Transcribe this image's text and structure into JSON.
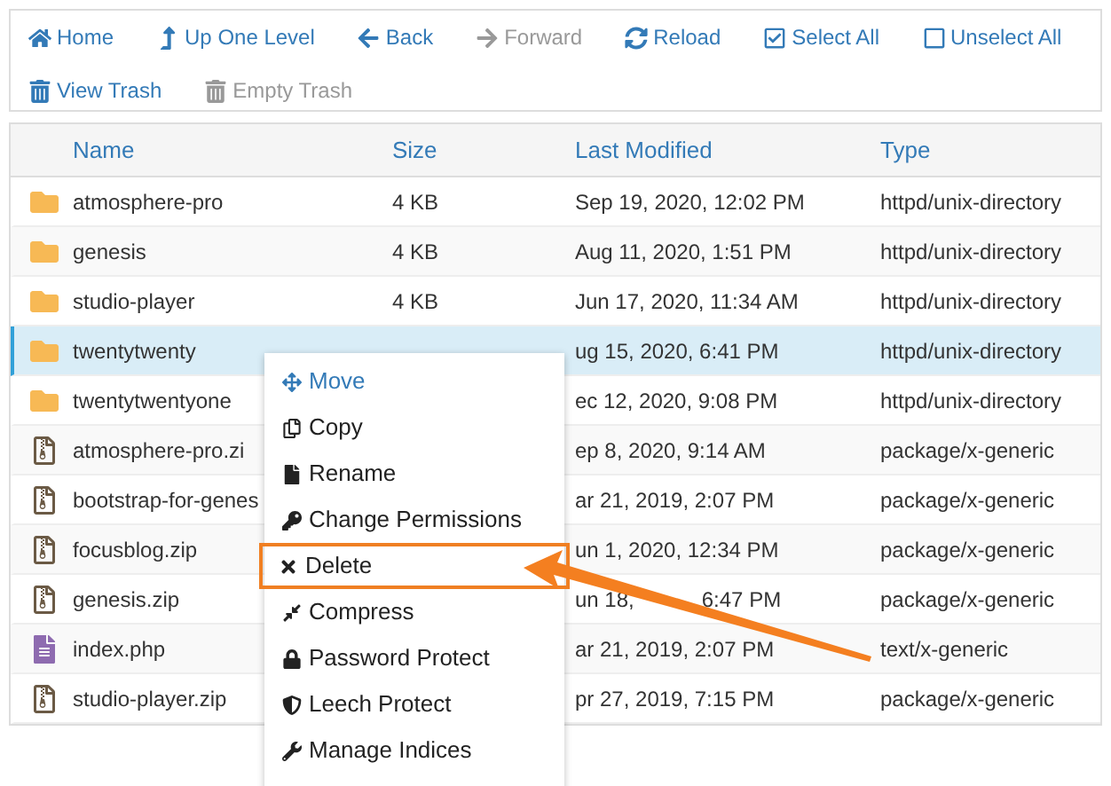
{
  "toolbar": [
    {
      "kind": "home",
      "label": "Home",
      "disabled": false
    },
    {
      "kind": "up",
      "label": "Up One Level",
      "disabled": false
    },
    {
      "kind": "back",
      "label": "Back",
      "disabled": false
    },
    {
      "kind": "forward",
      "label": "Forward",
      "disabled": true
    },
    {
      "kind": "reload",
      "label": "Reload",
      "disabled": false
    },
    {
      "kind": "select_all",
      "label": "Select All",
      "disabled": false
    },
    {
      "kind": "unselect_all",
      "label": "Unselect All",
      "disabled": false
    },
    {
      "kind": "view_trash",
      "label": "View Trash",
      "disabled": false
    },
    {
      "kind": "empty_trash",
      "label": "Empty Trash",
      "disabled": true
    }
  ],
  "table": {
    "columns": [
      "Name",
      "Size",
      "Last Modified",
      "Type"
    ],
    "rows": [
      {
        "kind": "folder",
        "name": "atmosphere-pro",
        "size": "4 KB",
        "modified": "Sep 19, 2020, 12:02 PM",
        "type": "httpd/unix-directory",
        "selected": false
      },
      {
        "kind": "folder",
        "name": "genesis",
        "size": "4 KB",
        "modified": "Aug 11, 2020, 1:51 PM",
        "type": "httpd/unix-directory",
        "selected": false
      },
      {
        "kind": "folder",
        "name": "studio-player",
        "size": "4 KB",
        "modified": "Jun 17, 2020, 11:34 AM",
        "type": "httpd/unix-directory",
        "selected": false
      },
      {
        "kind": "folder",
        "name": "twentytwenty",
        "modified": "ug 15, 2020, 6:41 PM",
        "type": "httpd/unix-directory",
        "selected": true
      },
      {
        "kind": "folder",
        "name": "twentytwentyone",
        "modified": "ec 12, 2020, 9:08 PM",
        "type": "httpd/unix-directory",
        "selected": false
      },
      {
        "kind": "archive",
        "name": "atmosphere-pro.zi",
        "modified": "ep 8, 2020, 9:14 AM",
        "type": "package/x-generic",
        "selected": false
      },
      {
        "kind": "archive",
        "name": "bootstrap-for-genes",
        "modified": "ar 21, 2019, 2:07 PM",
        "type": "package/x-generic",
        "selected": false
      },
      {
        "kind": "archive",
        "name": "focusblog.zip",
        "modified": "un 1, 2020, 12:34 PM",
        "type": "package/x-generic",
        "selected": false
      },
      {
        "kind": "archive",
        "name": "genesis.zip",
        "modified": "un 18,",
        "modified_tail": "6:47 PM",
        "type": "package/x-generic",
        "selected": false
      },
      {
        "kind": "text",
        "name": "index.php",
        "modified": "ar 21, 2019, 2:07 PM",
        "type": "text/x-generic",
        "selected": false
      },
      {
        "kind": "archive",
        "name": "studio-player.zip",
        "modified": "pr 27, 2019, 7:15 PM",
        "type": "package/x-generic",
        "selected": false
      }
    ]
  },
  "context_menu": {
    "items": [
      {
        "kind": "move",
        "label": "Move",
        "active": true,
        "highlighted": false
      },
      {
        "kind": "copy",
        "label": "Copy",
        "active": false,
        "highlighted": false
      },
      {
        "kind": "rename",
        "label": "Rename",
        "active": false,
        "highlighted": false
      },
      {
        "kind": "permissions",
        "label": "Change Permissions",
        "active": false,
        "highlighted": false
      },
      {
        "kind": "delete",
        "label": "Delete",
        "active": false,
        "highlighted": true
      },
      {
        "kind": "compress",
        "label": "Compress",
        "active": false,
        "highlighted": false
      },
      {
        "kind": "password",
        "label": "Password Protect",
        "active": false,
        "highlighted": false
      },
      {
        "kind": "leech",
        "label": "Leech Protect",
        "active": false,
        "highlighted": false
      },
      {
        "kind": "indices",
        "label": "Manage Indices",
        "active": false,
        "highlighted": false
      }
    ]
  }
}
